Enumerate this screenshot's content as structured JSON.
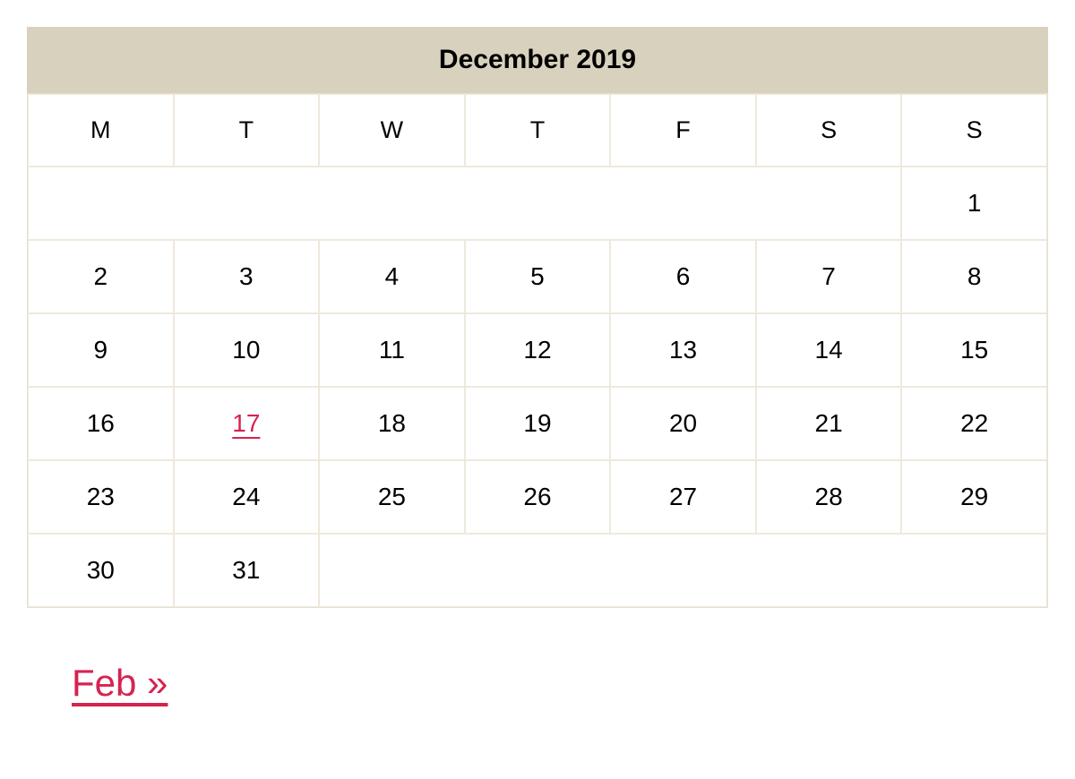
{
  "calendar": {
    "title": "December 2019",
    "weekdays": [
      "M",
      "T",
      "W",
      "T",
      "F",
      "S",
      "S"
    ],
    "weeks": [
      [
        {
          "day": "",
          "pad": true,
          "colspan": 6
        },
        {
          "day": "1"
        }
      ],
      [
        {
          "day": "2"
        },
        {
          "day": "3"
        },
        {
          "day": "4"
        },
        {
          "day": "5"
        },
        {
          "day": "6"
        },
        {
          "day": "7"
        },
        {
          "day": "8"
        }
      ],
      [
        {
          "day": "9"
        },
        {
          "day": "10"
        },
        {
          "day": "11"
        },
        {
          "day": "12"
        },
        {
          "day": "13"
        },
        {
          "day": "14"
        },
        {
          "day": "15"
        }
      ],
      [
        {
          "day": "16"
        },
        {
          "day": "17",
          "link": true
        },
        {
          "day": "18"
        },
        {
          "day": "19"
        },
        {
          "day": "20"
        },
        {
          "day": "21"
        },
        {
          "day": "22"
        }
      ],
      [
        {
          "day": "23"
        },
        {
          "day": "24"
        },
        {
          "day": "25"
        },
        {
          "day": "26"
        },
        {
          "day": "27"
        },
        {
          "day": "28"
        },
        {
          "day": "29"
        }
      ],
      [
        {
          "day": "30"
        },
        {
          "day": "31"
        },
        {
          "day": "",
          "pad": true,
          "colspan": 5
        }
      ]
    ]
  },
  "nav": {
    "next_label": "Feb »"
  }
}
